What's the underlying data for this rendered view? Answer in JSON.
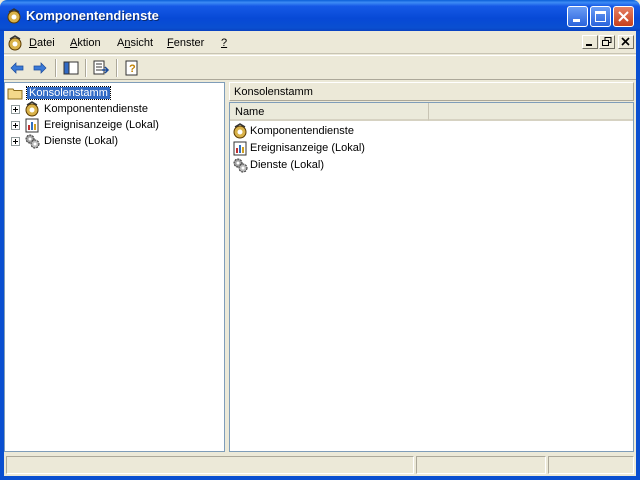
{
  "window": {
    "title": "Komponentendienste"
  },
  "menubar": {
    "items": [
      {
        "label": "Datei",
        "accel": "D"
      },
      {
        "label": "Aktion",
        "accel": "A"
      },
      {
        "label": "Ansicht",
        "accel": "n"
      },
      {
        "label": "Fenster",
        "accel": "F"
      },
      {
        "label": "?",
        "accel": "?"
      }
    ]
  },
  "toolbar": {
    "buttons": [
      "back-arrow-icon",
      "forward-arrow-icon",
      "show-hide-tree-icon",
      "export-list-icon",
      "help-icon"
    ]
  },
  "tree": {
    "root": "Konsolenstamm",
    "items": [
      {
        "label": "Komponentendienste",
        "icon": "component-services-icon"
      },
      {
        "label": "Ereignisanzeige (Lokal)",
        "icon": "event-viewer-icon"
      },
      {
        "label": "Dienste (Lokal)",
        "icon": "services-gear-icon"
      }
    ]
  },
  "right": {
    "header": "Konsolenstamm",
    "columns": [
      "Name",
      ""
    ],
    "rows": [
      {
        "label": "Komponentendienste",
        "icon": "component-services-icon"
      },
      {
        "label": "Ereignisanzeige (Lokal)",
        "icon": "event-viewer-icon"
      },
      {
        "label": "Dienste (Lokal)",
        "icon": "services-gear-icon"
      }
    ]
  },
  "colors": {
    "titlebar": "#0a4fd0",
    "selection": "#316ac5",
    "chrome": "#ece9d8"
  }
}
